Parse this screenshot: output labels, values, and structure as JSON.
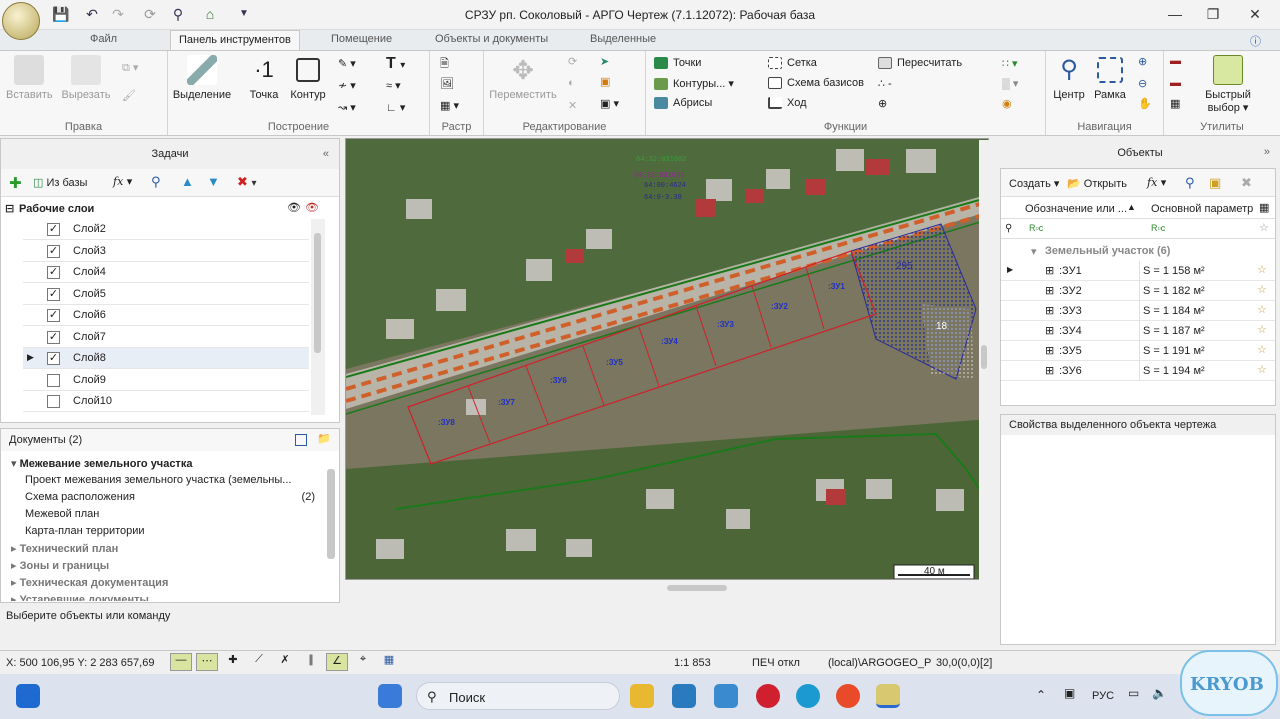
{
  "window": {
    "title": "СРЗУ рп. Соколовый - АРГО Чертеж (7.1.12072): Рабочая база"
  },
  "tabs": [
    "Файл",
    "Панель инструментов",
    "Помещение",
    "Объекты и документы",
    "Выделенные"
  ],
  "ribbon": {
    "groups": {
      "edit": "Правка",
      "build": "Построение",
      "raster": "Растр",
      "editing": "Редактирование",
      "functions": "Функции",
      "nav": "Навигация",
      "utils": "Утилиты"
    },
    "paste": "Вставить",
    "cut": "Вырезать",
    "select": "Выделение",
    "point": "Точка",
    "contour": "Контур",
    "move": "Переместить",
    "points": "Точки",
    "contours": "Контуры...",
    "abrisy": "Абрисы",
    "grid": "Сетка",
    "basis_scheme": "Схема базисов",
    "hod": "Ход",
    "recalc": "Пересчитать",
    "center": "Центр",
    "frame": "Рамка",
    "quick_select_1": "Быстрый",
    "quick_select_2": "выбор"
  },
  "tasks": {
    "header": "Задачи",
    "from_base": "Из базы",
    "fx": "fx",
    "layers_title": "Рабочие слои",
    "layers": [
      {
        "name": "Слой2",
        "checked": true
      },
      {
        "name": "Слой3",
        "checked": true
      },
      {
        "name": "Слой4",
        "checked": true
      },
      {
        "name": "Слой5",
        "checked": true
      },
      {
        "name": "Слой6",
        "checked": true
      },
      {
        "name": "Слой7",
        "checked": true
      },
      {
        "name": "Слой8",
        "checked": true
      },
      {
        "name": "Слой9",
        "checked": false
      },
      {
        "name": "Слой10",
        "checked": false
      }
    ]
  },
  "documents": {
    "header": "Документы (2)",
    "groups": [
      {
        "title": "Межевание земельного участка",
        "expanded": true
      },
      {
        "title": "Технический план"
      },
      {
        "title": "Зоны и границы"
      },
      {
        "title": "Техническая документация"
      },
      {
        "title": "Устаревшие документы"
      }
    ],
    "items": [
      {
        "label": "Проект межевания земельного участка (земельны...",
        "count": ""
      },
      {
        "label": "Схема расположения",
        "count": "(2)"
      },
      {
        "label": "Межевой план",
        "count": ""
      },
      {
        "label": "Карта-план территории",
        "count": ""
      }
    ]
  },
  "status_hint": "Выберите объекты или команду",
  "map": {
    "labels": [
      ":ЗУ1",
      ":ЗУ2",
      ":ЗУ3",
      ":ЗУ4",
      ":ЗУ5",
      ":ЗУ6",
      ":ЗУ7",
      ":ЗУ8"
    ],
    "number_295": "295",
    "number_18": "18",
    "cad1": "64:32:031002",
    "cad2": "64:32:031632",
    "cad3": "64:00:4624",
    "cad4": "64:0-3.38",
    "scale_bar": "40 м"
  },
  "objects": {
    "header": "Объекты",
    "create": "Создать",
    "open": "Открыть",
    "fx": "fx",
    "col1": "Обозначение или ...",
    "col2": "Основной параметр",
    "group": "Земельный участок (6)",
    "rows": [
      {
        "name": ":ЗУ1",
        "param": "S = 1 158 м²"
      },
      {
        "name": ":ЗУ2",
        "param": "S = 1 182 м²"
      },
      {
        "name": ":ЗУ3",
        "param": "S = 1 184 м²"
      },
      {
        "name": ":ЗУ4",
        "param": "S = 1 187 м²"
      },
      {
        "name": ":ЗУ5",
        "param": "S = 1 191 м²"
      },
      {
        "name": ":ЗУ6",
        "param": "S = 1 194 м²"
      }
    ],
    "props_title": "Свойства выделенного объекта чертежа"
  },
  "statusbar": {
    "coords": "X: 500 106,95 Y: 2 283 657,69",
    "scale": "1:1 853",
    "print": "ПЕЧ откл",
    "db": "(local)\\ARGOGEO_P",
    "angle": "30,0(0,0)[2]"
  },
  "taskbar": {
    "search": "Поиск",
    "lang": "РУС"
  },
  "watermark": "KRYOB",
  "colors": {
    "accent": "#1e5aa8",
    "parcel_line": "#d0202a",
    "boundary": "#1a7a1a",
    "label": "#2030c8"
  }
}
